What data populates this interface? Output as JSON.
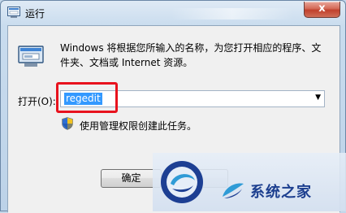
{
  "window": {
    "title": "运行",
    "close_symbol": "x"
  },
  "dialog": {
    "description": "Windows 将根据您所输入的名称，为您打开相应的程序、文件夹、文档或 Internet 资源。",
    "open_label": "打开(O):",
    "open_value": "regedit",
    "admin_note": "使用管理权限创建此任务。"
  },
  "buttons": {
    "ok_label": "确定"
  },
  "watermark": {
    "brand_text": "系统之家"
  },
  "colors": {
    "highlight_border": "#e8121d",
    "selection": "#3399ff",
    "watermark_text": "#1c3f8f"
  }
}
